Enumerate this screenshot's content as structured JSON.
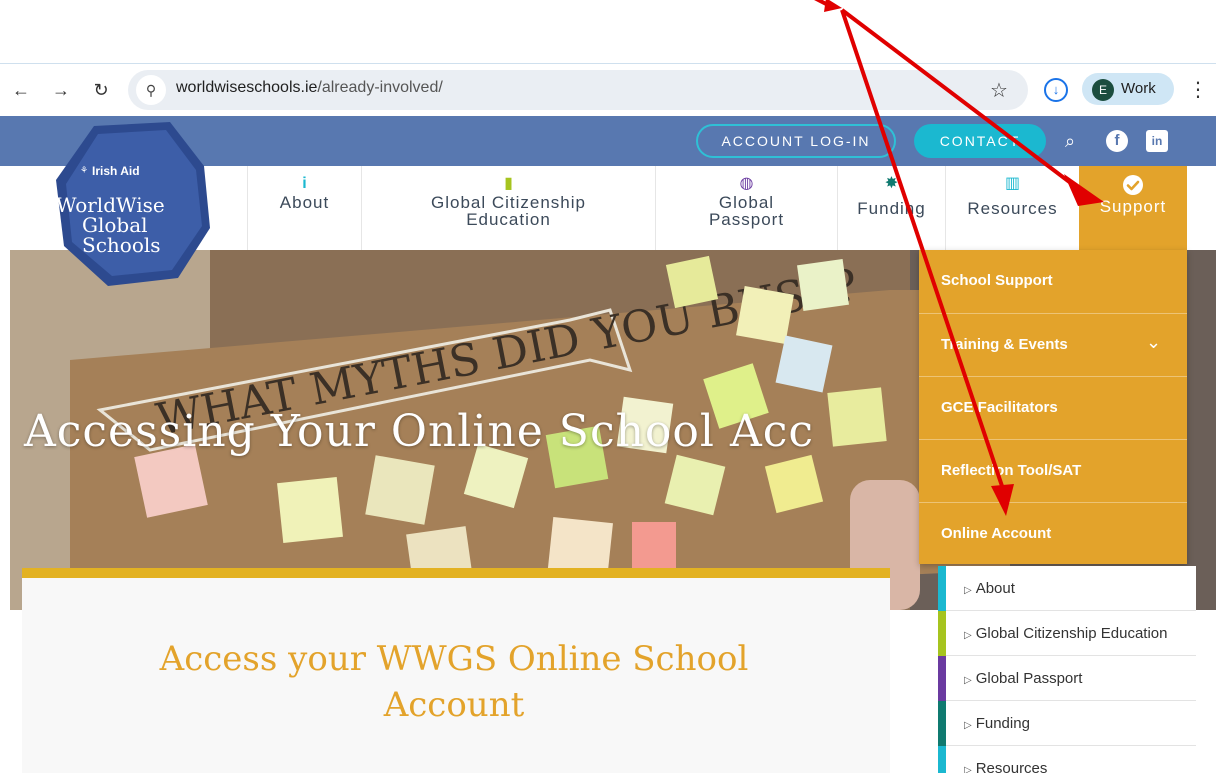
{
  "browser": {
    "url_domain": "worldwiseschools.ie",
    "url_path": "/already-involved/",
    "profile_initial": "E",
    "profile_name": "Work",
    "icons": {
      "back": "back-arrow-icon",
      "forward": "forward-arrow-icon",
      "reload": "reload-icon",
      "site_info": "site-info-icon",
      "bookmark": "star-icon",
      "download": "download-icon",
      "menu": "kebab-menu-icon"
    }
  },
  "utility": {
    "login_label": "ACCOUNT LOG-IN",
    "contact_label": "CONTACT",
    "icons": [
      "search-icon",
      "facebook-icon",
      "linkedin-icon"
    ]
  },
  "logo": {
    "agency": "Irish Aid",
    "line1": "WorldWise",
    "line2": "Global",
    "line3": "Schools"
  },
  "nav": {
    "items": [
      {
        "label": "About",
        "icon": "info-icon"
      },
      {
        "label_line1": "Global Citizenship",
        "label_line2": "Education",
        "icon": "book-icon"
      },
      {
        "label_line1": "Global",
        "label_line2": "Passport",
        "icon": "globe-icon"
      },
      {
        "label": "Funding",
        "icon": "gear-icon"
      },
      {
        "label": "Resources",
        "icon": "books-icon"
      },
      {
        "label": "Support",
        "icon": "check-circle-icon"
      }
    ]
  },
  "hero": {
    "title": "Accessing Your Online School Acc",
    "board_text": "WHAT MYTHS DID YOU BUST?"
  },
  "dropdown": {
    "items": [
      {
        "label": "School Support"
      },
      {
        "label": "Training & Events",
        "has_submenu": true
      },
      {
        "label": "GCE Facilitators"
      },
      {
        "label": "Reflection Tool/SAT"
      },
      {
        "label": "Online Account"
      }
    ]
  },
  "content": {
    "title": "Access your WWGS Online School Account"
  },
  "sidebar": {
    "items": [
      {
        "label": "About",
        "color": "#1bb8d0"
      },
      {
        "label": "Global Citizenship Education",
        "color": "#a6c41f"
      },
      {
        "label": "Global Passport",
        "color": "#6a3aa0"
      },
      {
        "label": "Funding",
        "color": "#0f7a70"
      },
      {
        "label": "Resources",
        "color": "#1bb8d0"
      }
    ]
  },
  "colors": {
    "utility_bar": "#5878b0",
    "accent_teal": "#1bb8d0",
    "support_orange": "#e3a32b",
    "annotation_red": "#e00000"
  }
}
